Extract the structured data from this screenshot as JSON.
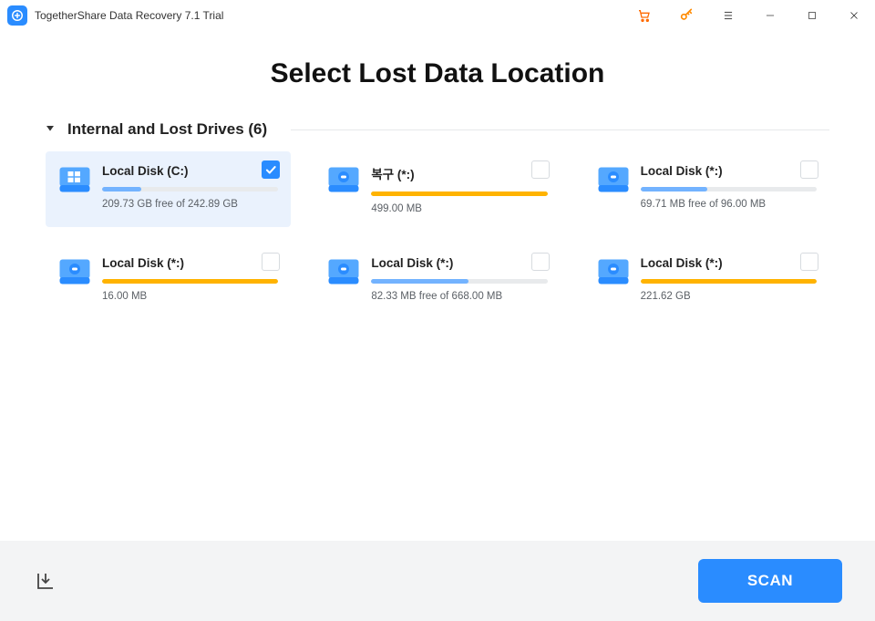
{
  "titlebar": {
    "title": "TogetherShare Data Recovery 7.1 Trial"
  },
  "page": {
    "title": "Select Lost Data Location"
  },
  "section": {
    "title": "Internal and Lost Drives (6)"
  },
  "drives": [
    {
      "name": "Local Disk (C:)",
      "sub": "209.73 GB free of 242.89 GB",
      "fillPercent": 22,
      "fillColor": "#73b3ff",
      "iconType": "windows",
      "checked": true
    },
    {
      "name": "복구 (*:)",
      "sub": "499.00 MB",
      "fillPercent": 100,
      "fillColor": "#ffb300",
      "iconType": "hdd",
      "checked": false
    },
    {
      "name": "Local Disk (*:)",
      "sub": "69.71 MB free of 96.00 MB",
      "fillPercent": 38,
      "fillColor": "#73b3ff",
      "iconType": "hdd",
      "checked": false
    },
    {
      "name": "Local Disk (*:)",
      "sub": "16.00 MB",
      "fillPercent": 100,
      "fillColor": "#ffb300",
      "iconType": "hdd",
      "checked": false
    },
    {
      "name": "Local Disk (*:)",
      "sub": "82.33 MB free of 668.00 MB",
      "fillPercent": 55,
      "fillColor": "#73b3ff",
      "iconType": "hdd",
      "checked": false
    },
    {
      "name": "Local Disk (*:)",
      "sub": "221.62 GB",
      "fillPercent": 100,
      "fillColor": "#ffb300",
      "iconType": "hdd",
      "checked": false
    }
  ],
  "footer": {
    "scan": "SCAN"
  }
}
